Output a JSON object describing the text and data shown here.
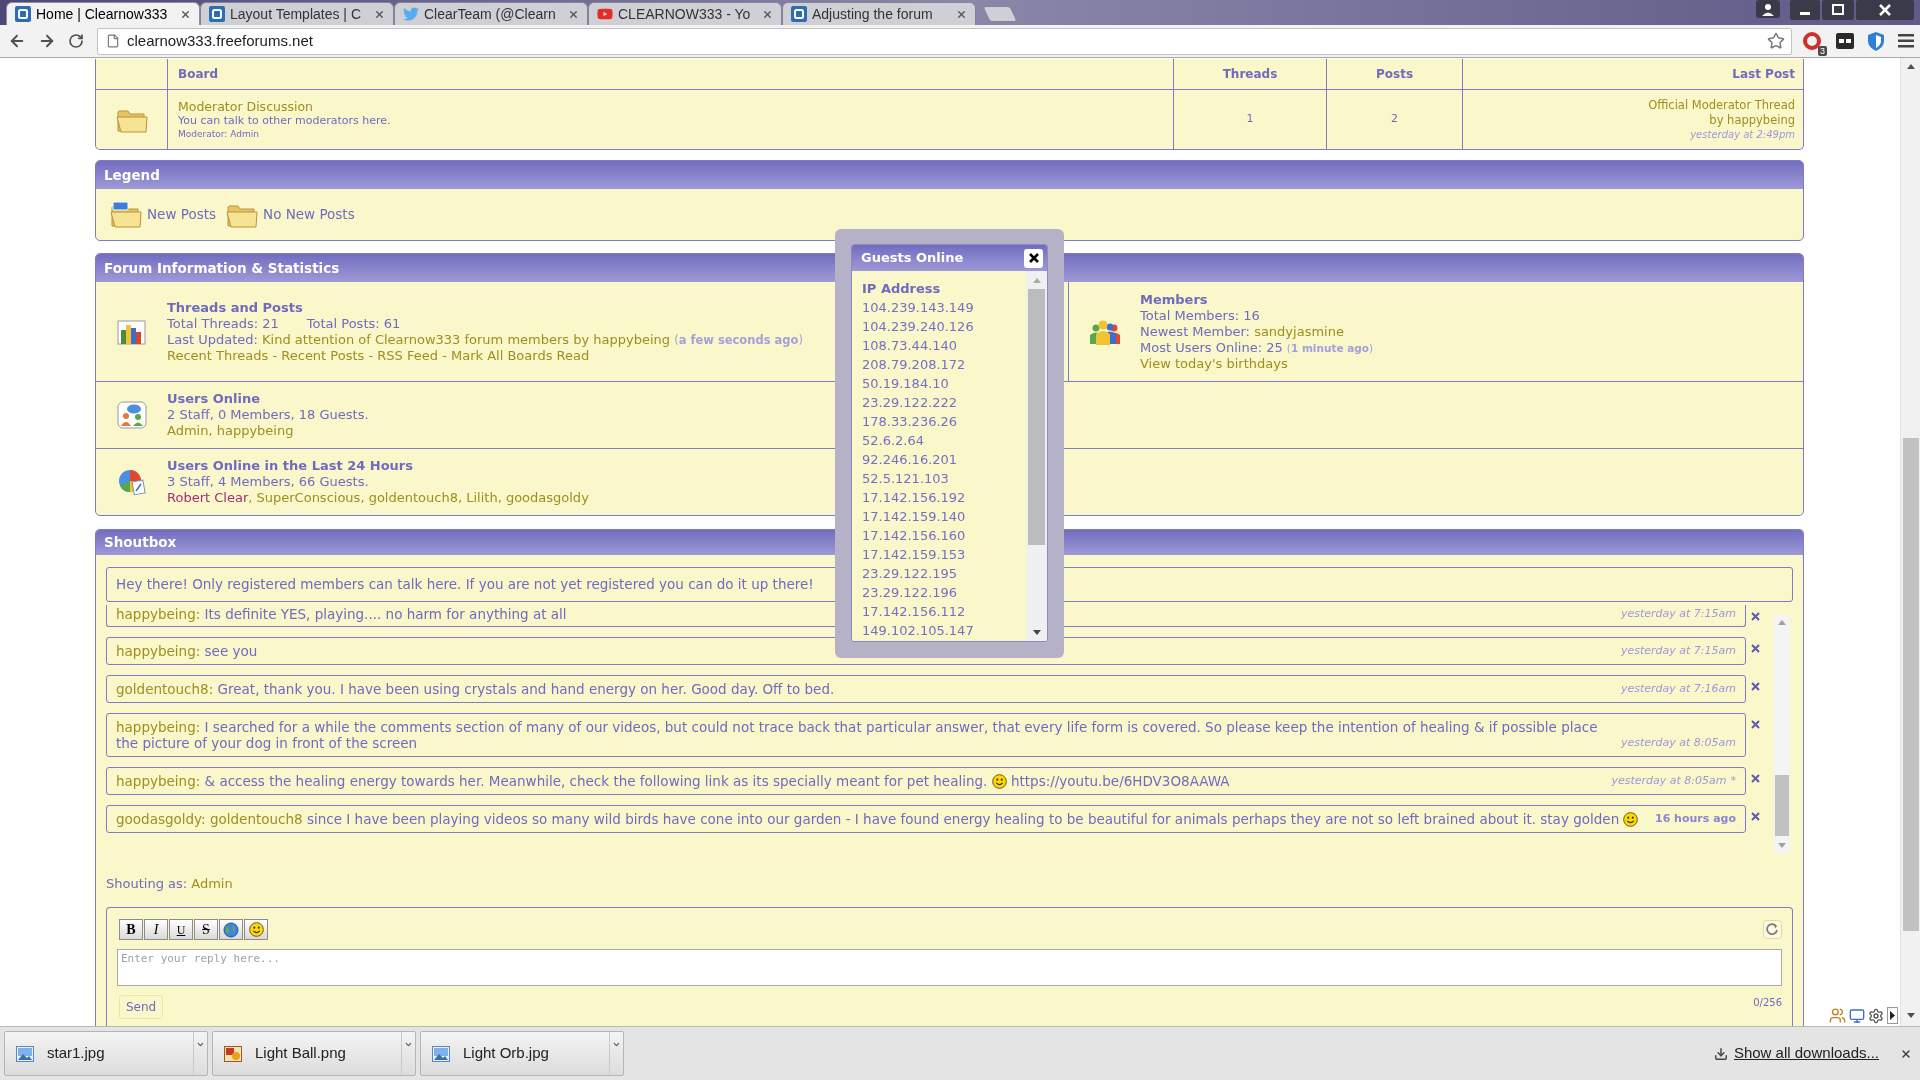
{
  "browser": {
    "tabs": [
      {
        "title": "Home | Clearnow333",
        "kind": "proboards",
        "selected": true
      },
      {
        "title": "Layout Templates | C",
        "kind": "proboards",
        "selected": false
      },
      {
        "title": "ClearTeam (@Clearn",
        "kind": "twitter",
        "selected": false
      },
      {
        "title": "CLEARNOW333 - Yo",
        "kind": "youtube",
        "selected": false
      },
      {
        "title": "Adjusting the forum",
        "kind": "proboards",
        "selected": false
      }
    ],
    "address": "clearnow333.freeforums.net",
    "extension_badge": "3"
  },
  "board_table": {
    "columns": [
      "Board",
      "Threads",
      "Posts",
      "Last Post"
    ],
    "rows": [
      {
        "new_posts": false,
        "name": "Moderator Discussion",
        "description": "You can talk to other moderators here.",
        "moderators": "Moderator: Admin",
        "threads": "1",
        "posts": "2",
        "last_post": {
          "thread": "Official Moderator Thread",
          "by": "by",
          "user": "happybeing",
          "time": "yesterday at 2:49pm"
        }
      }
    ]
  },
  "legend": {
    "title": "Legend",
    "items": [
      {
        "kind": "new",
        "label": "New Posts"
      },
      {
        "kind": "no_new",
        "label": "No New Posts"
      }
    ]
  },
  "forum_info": {
    "title": "Forum Information & Statistics",
    "threads_posts": {
      "title": "Threads and Posts",
      "total_threads": "Total Threads: 21",
      "total_posts": "Total Posts: 61",
      "last_updated_label": "Last Updated:",
      "last_updated_thread": "Kind attention of Clearnow333 forum members",
      "last_updated_by": "by",
      "last_updated_user": "happybeing",
      "last_updated_ago": "(**a few seconds ago**)",
      "links": [
        "Recent Threads",
        "Recent Posts",
        "RSS Feed",
        "Mark All Boards Read"
      ],
      "link_separator": "-"
    },
    "members": {
      "title": "Members",
      "total": "Total Members: 16",
      "newest_label": "Newest Member:",
      "newest": "sandyjasmine",
      "most_online": "Most Users Online: 25",
      "most_online_when": "(**1 minute ago**)",
      "birthdays": "View today's birthdays"
    },
    "users_online": {
      "title": "Users Online",
      "summary": "2 Staff, 0 Members, 18 Guests.",
      "separator": ",",
      "users": [
        {
          "name": "Admin",
          "color": "#a08e1e"
        },
        {
          "name": "happybeing",
          "color": "#a08e1e"
        }
      ]
    },
    "users_24h": {
      "title": "Users Online in the Last 24 Hours",
      "summary": "3 Staff, 4 Members, 66 Guests.",
      "separator": ",",
      "users": [
        {
          "name": "Robert Clear",
          "color": "#a0306e"
        },
        {
          "name": "SuperConscious",
          "color": "#a08e1e"
        },
        {
          "name": "goldentouch8",
          "color": "#a08e1e"
        },
        {
          "name": "Lilith",
          "color": "#a08e1e"
        },
        {
          "name": "goodasgoldy",
          "color": "#a08e1e"
        }
      ]
    }
  },
  "popup": {
    "title": "Guests Online",
    "column": "IP Address",
    "ips": [
      "104.239.143.149",
      "104.239.240.126",
      "108.73.44.140",
      "208.79.208.172",
      "50.19.184.10",
      "23.29.122.222",
      "178.33.236.26",
      "52.6.2.64",
      "92.246.16.201",
      "52.5.121.103",
      "17.142.156.192",
      "17.142.159.140",
      "17.142.156.160",
      "17.142.159.153",
      "23.29.122.195",
      "23.29.122.196",
      "17.142.156.112",
      "149.102.105.147"
    ]
  },
  "shoutbox": {
    "title": "Shoutbox",
    "notice": "Hey there! Only registered members can talk here. If you are not yet registered you can do it up there!",
    "messages": [
      {
        "author": "happybeing:",
        "parts": [
          {
            "kind": "text",
            "text": "Its definite YES, playing.... no harm for anything at all"
          }
        ],
        "time": "yesterday at 7:15am",
        "time_bold": false
      },
      {
        "author": "happybeing:",
        "parts": [
          {
            "kind": "text",
            "text": "see you"
          }
        ],
        "time": "yesterday at 7:15am",
        "time_bold": false
      },
      {
        "author": "goldentouch8:",
        "parts": [
          {
            "kind": "text",
            "text": "Great, thank you. I have been using crystals and hand energy on her. Good day. Off to bed."
          }
        ],
        "time": "yesterday at 7:16am",
        "time_bold": false
      },
      {
        "author": "happybeing:",
        "parts": [
          {
            "kind": "text",
            "text": "I searched for a while the comments section of many of our videos, but could not trace back that particular answer, that every life form is covered. So please keep the intention of healing & if possible place the picture of your dog in front of the screen"
          }
        ],
        "time": "yesterday at 8:05am",
        "time_bold": false
      },
      {
        "author": "happybeing:",
        "parts": [
          {
            "kind": "text",
            "text": "& access the healing energy towards her. Meanwhile, check the following link as its specially meant for pet healing."
          },
          {
            "kind": "smiley"
          },
          {
            "kind": "link",
            "text": "https://youtu.be/6HDV3O8AAWA"
          }
        ],
        "time": "yesterday at 8:05am",
        "edited": "*",
        "time_bold": false
      },
      {
        "author": "goodasgoldy:",
        "parts": [
          {
            "kind": "mention",
            "text": "goldentouch8"
          },
          {
            "kind": "text",
            "text": "since I have been playing videos so many wild birds have cone into our garden - I have found energy healing to be beautiful for animals perhaps they are not so left brained about it. stay golden"
          },
          {
            "kind": "smiley"
          }
        ],
        "time": "16 hours ago",
        "time_bold": true
      }
    ],
    "shouting_as_label": "Shouting as:",
    "shouting_as": "Admin",
    "toolbar": [
      {
        "kind": "bold",
        "label": "B"
      },
      {
        "kind": "italic",
        "label": "I"
      },
      {
        "kind": "underline",
        "label": "U"
      },
      {
        "kind": "strike",
        "label": "S"
      },
      {
        "kind": "link"
      },
      {
        "kind": "smiley"
      }
    ],
    "placeholder": "Enter your reply here...",
    "send": "Send",
    "counter": "0/256"
  },
  "downloads": {
    "items": [
      {
        "name": "star1.jpg",
        "kind": "image"
      },
      {
        "name": "Light Ball.png",
        "kind": "png"
      },
      {
        "name": "Light Orb.jpg",
        "kind": "image"
      }
    ],
    "show_all": "Show all downloads..."
  }
}
